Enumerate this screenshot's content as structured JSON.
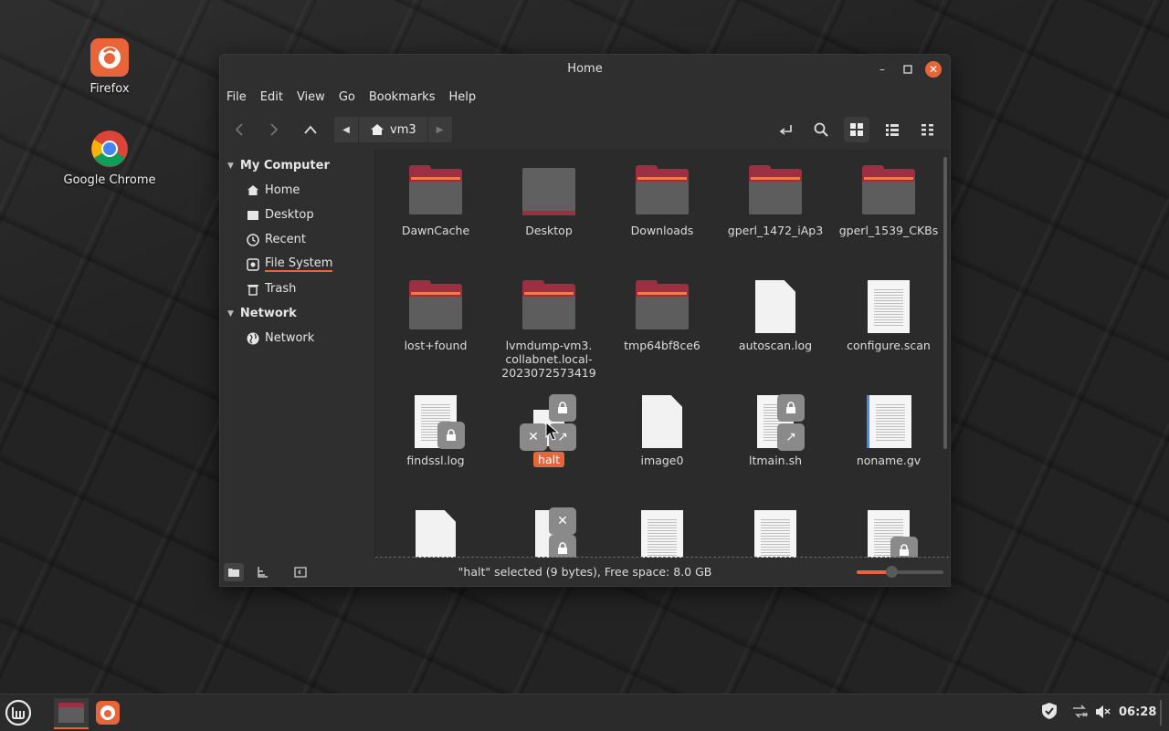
{
  "desktop": {
    "icons": [
      {
        "label": "Firefox"
      },
      {
        "label": "Google Chrome"
      }
    ]
  },
  "window": {
    "title": "Home",
    "menu": [
      "File",
      "Edit",
      "View",
      "Go",
      "Bookmarks",
      "Help"
    ],
    "breadcrumb": {
      "current": "vm3"
    },
    "sidebar": {
      "sections": [
        {
          "header": "My Computer",
          "items": [
            "Home",
            "Desktop",
            "Recent",
            "File System",
            "Trash"
          ]
        },
        {
          "header": "Network",
          "items": [
            "Network"
          ]
        }
      ]
    },
    "files": [
      {
        "name": "DawnCache",
        "kind": "folder"
      },
      {
        "name": "Desktop",
        "kind": "desktop-folder"
      },
      {
        "name": "Downloads",
        "kind": "folder"
      },
      {
        "name": "gperl_1472_iAp3",
        "kind": "folder"
      },
      {
        "name": "gperl_1539_CKBs",
        "kind": "folder"
      },
      {
        "name": "lost+found",
        "kind": "folder"
      },
      {
        "name": "lvmdump-vm3.\ncollabnet.local-\n2023072573419",
        "kind": "folder"
      },
      {
        "name": "tmp64bf8ce6",
        "kind": "folder"
      },
      {
        "name": "autoscan.log",
        "kind": "file"
      },
      {
        "name": "configure.scan",
        "kind": "text"
      },
      {
        "name": "findssl.log",
        "kind": "text-locked"
      },
      {
        "name": "halt",
        "kind": "link-broken-locked",
        "selected": true
      },
      {
        "name": "image0",
        "kind": "file"
      },
      {
        "name": "ltmain.sh",
        "kind": "text-link-locked"
      },
      {
        "name": "noname.gv",
        "kind": "text-blue"
      }
    ],
    "status": "\"halt\" selected (9 bytes), Free space: 8.0 GB",
    "zoom_level": 0.4
  },
  "taskbar": {
    "clock": "06:28"
  },
  "colors": {
    "accent": "#e8653a",
    "folder": "#9d2f43"
  }
}
